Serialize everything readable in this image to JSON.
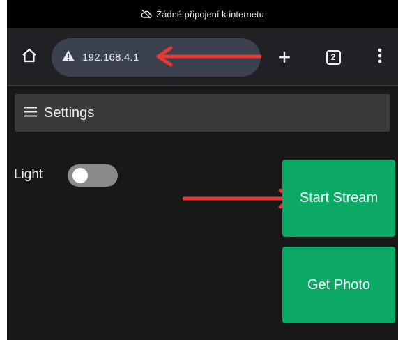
{
  "status_bar": {
    "text": "Žádné připojení k internetu",
    "icon": "cloud-off-icon"
  },
  "toolbar": {
    "home_icon": "home-icon",
    "url_warning_icon": "warning-triangle-icon",
    "url": "192.168.4.1",
    "new_tab_label": "+",
    "tab_count": "2",
    "menu_icon": "more-vertical-icon"
  },
  "app": {
    "settings_label": "Settings",
    "settings_icon": "hamburger-icon",
    "light_label": "Light",
    "light_on": false,
    "start_stream_label": "Start Stream",
    "get_photo_label": "Get Photo"
  },
  "colors": {
    "status_bar": "#000000",
    "toolbar": "#202124",
    "url_bar": "#3c4150",
    "page_bg": "#181818",
    "settings_bar": "#3a3a3a",
    "button_green": "#0ba866",
    "toggle_off": "#8a8a8a",
    "annotation_arrow": "#e53935"
  }
}
